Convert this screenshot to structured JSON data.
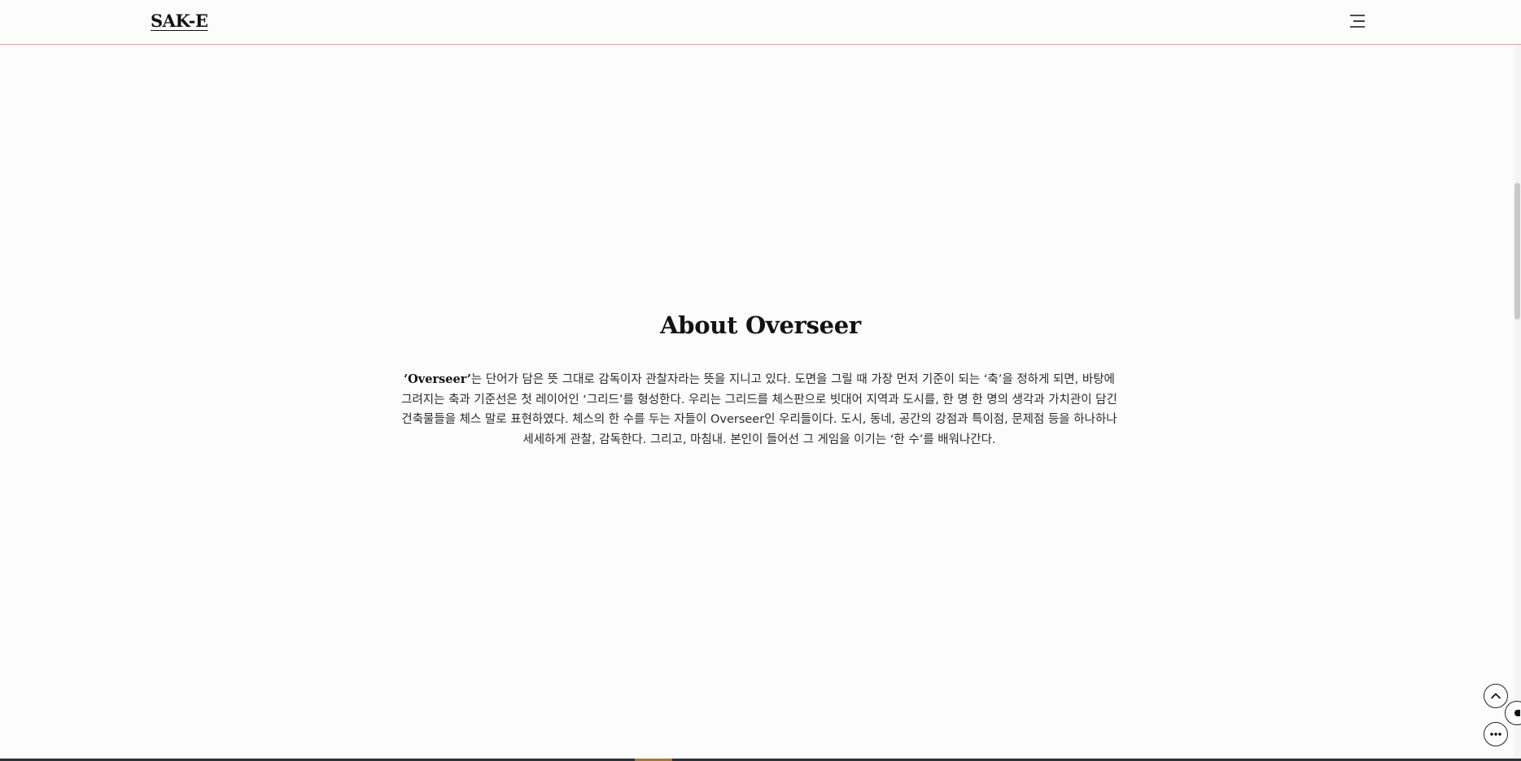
{
  "header": {
    "logo_text": "SAK-E",
    "menu_icon": "hamburger-menu-icon"
  },
  "main": {
    "title": "About Overseer",
    "intro_highlight": "‘Overseer’",
    "intro_text": "는 단어가 담은 뜻 그대로 감독이자 관찰자라는 뜻을 지니고 있다. 도면을 그릴 때 가장 먼저 기준이 되는 ‘축’을 정하게 되면, 바탕에 그려지는 축과 기준선은 첫 레이어인 ‘그리드’를 형성한다. 우리는 그리드를 체스판으로 빗대어 지역과 도시를, 한 명 한 명의 생각과 가치관이 담긴 건축물들을 체스 말로 표현하였다. 체스의 한 수를 두는 자들이 Overseer인 우리들이다. 도시, 동네, 공간의 강점과 특이점, 문제점 등을 하나하나 세세하게 관찰, 감독한다. 그리고, 마침내. 본인이 들어선 그 게임을 이기는 ‘한 수’를 배워나간다."
  },
  "floating": {
    "top_icon": "chevron-up-icon",
    "chat_icon": "chat-bubble-icon",
    "side_icon": "side-tab-icon"
  },
  "colors": {
    "background": "#fcfcfc",
    "header_border": "#d9a6ae",
    "text": "#1b1b1b"
  }
}
